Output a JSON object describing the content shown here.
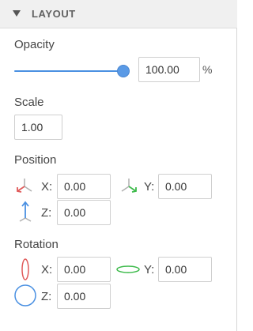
{
  "header": {
    "title": "LAYOUT",
    "collapse_icon": "triangle-down-icon"
  },
  "colors": {
    "accent": "#4a90e2",
    "x_axis": "#e05a5a",
    "y_axis": "#3cba4a",
    "z_axis": "#4a90e2"
  },
  "opacity": {
    "label": "Opacity",
    "value": "100.00",
    "unit": "%",
    "slider_level": 1.0
  },
  "scale": {
    "label": "Scale",
    "value": "1.00"
  },
  "position": {
    "label": "Position",
    "x": {
      "label": "X:",
      "value": "0.00",
      "icon": "axis-x-arrow-icon"
    },
    "y": {
      "label": "Y:",
      "value": "0.00",
      "icon": "axis-y-arrow-icon"
    },
    "z": {
      "label": "Z:",
      "value": "0.00",
      "icon": "axis-z-arrow-icon"
    }
  },
  "rotation": {
    "label": "Rotation",
    "x": {
      "label": "X:",
      "value": "0.00",
      "icon": "rotate-x-ellipse-icon"
    },
    "y": {
      "label": "Y:",
      "value": "0.00",
      "icon": "rotate-y-ellipse-icon"
    },
    "z": {
      "label": "Z:",
      "value": "0.00",
      "icon": "rotate-z-circle-icon"
    }
  }
}
